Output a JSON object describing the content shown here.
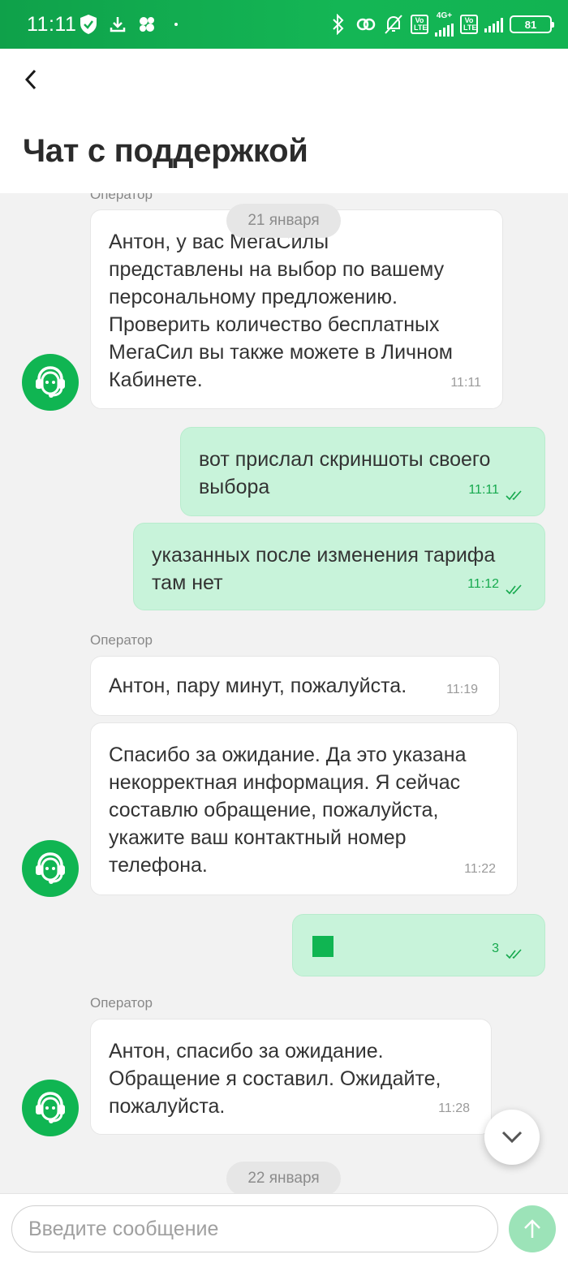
{
  "status_bar": {
    "time": "11:11",
    "battery": "81",
    "network": "4G+",
    "volte_label": "Vo LTE",
    "left_icons": [
      "shield-check-icon",
      "download-icon",
      "clover-icon",
      "dot-icon"
    ],
    "right_icons": [
      "bluetooth-icon",
      "link-icon",
      "mute-bell-icon",
      "volte-icon",
      "signal-icon",
      "volte-icon",
      "signal-icon",
      "battery-icon"
    ]
  },
  "header": {
    "back_icon": "chevron-left-icon",
    "title": "Чат с поддержкой"
  },
  "chat": {
    "messages": [
      {
        "sender": "Оператор",
        "text": "Антон, у вас МегаСилы\nпредставлены на выбор по вашему\nперсональному предложению.\nПроверить количество бесплатных\nМегаСил вы также можете в Личном\nКабинете.",
        "time": "11:11"
      },
      {
        "date": "21 января"
      },
      {
        "text": "вот прислал скриншоты своего\nвыбора",
        "time": "11:11",
        "status": "read"
      },
      {
        "text": "указанных после изменения тарифа\nтам нет",
        "time": "11:12",
        "status": "read"
      },
      {
        "sender": "Оператор",
        "text": "Антон, пару минут, пожалуйста.",
        "time": "11:19"
      },
      {
        "text": "Спасибо за ожидание. Да это указана\nнекорректная информация. Я сейчас\nсоставлю обращение, пожалуйста,\nукажите ваш контактный номер\nтелефона.",
        "time": "11:22"
      },
      {
        "text": "",
        "time": "3",
        "status": "read"
      },
      {
        "sender": "Оператор",
        "text": "Антон, спасибо за ожидание.\nОбращение я составил. Ожидайте,\nпожалуйста.",
        "time": "11:28"
      },
      {
        "date": "22 января"
      }
    ]
  },
  "input": {
    "placeholder": "Введите сообщение",
    "value": ""
  },
  "colors": {
    "brand_green": "#10b552",
    "outgoing_bubble": "#c8f3da",
    "send_button": "#9ce3b8"
  }
}
